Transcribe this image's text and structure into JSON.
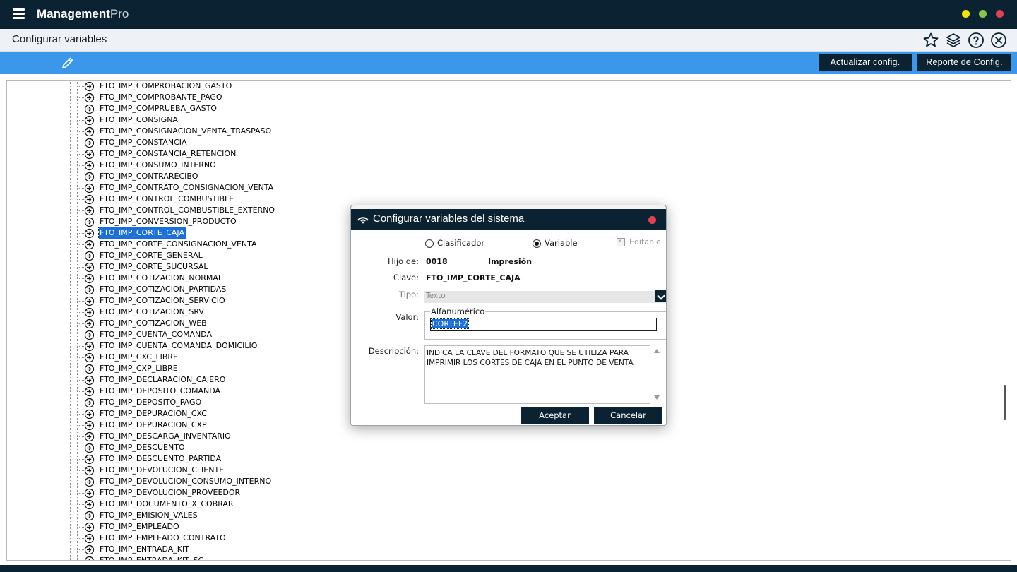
{
  "app": {
    "brand_bold": "Management",
    "brand_light": "Pro",
    "window_dots": [
      "#f5e20a",
      "#8bc34a",
      "#e0434e"
    ]
  },
  "header": {
    "title": "Configurar variables",
    "icons": [
      "star-icon",
      "layers-icon",
      "help-icon",
      "close-circle-icon"
    ]
  },
  "toolbar": {
    "edit_icon": "pencil-icon",
    "update_label": "Actualizar config.",
    "report_label": "Reporte de Config."
  },
  "tree": {
    "selected": "FTO_IMP_CORTE_CAJA",
    "items": [
      "FTO_IMP_COMPROBACION_GASTO",
      "FTO_IMP_COMPROBANTE_PAGO",
      "FTO_IMP_COMPRUEBA_GASTO",
      "FTO_IMP_CONSIGNA",
      "FTO_IMP_CONSIGNACION_VENTA_TRASPASO",
      "FTO_IMP_CONSTANCIA",
      "FTO_IMP_CONSTANCIA_RETENCION",
      "FTO_IMP_CONSUMO_INTERNO",
      "FTO_IMP_CONTRARECIBO",
      "FTO_IMP_CONTRATO_CONSIGNACION_VENTA",
      "FTO_IMP_CONTROL_COMBUSTIBLE",
      "FTO_IMP_CONTROL_COMBUSTIBLE_EXTERNO",
      "FTO_IMP_CONVERSION_PRODUCTO",
      "FTO_IMP_CORTE_CAJA",
      "FTO_IMP_CORTE_CONSIGNACION_VENTA",
      "FTO_IMP_CORTE_GENERAL",
      "FTO_IMP_CORTE_SUCURSAL",
      "FTO_IMP_COTIZACION_NORMAL",
      "FTO_IMP_COTIZACION_PARTIDAS",
      "FTO_IMP_COTIZACION_SERVICIO",
      "FTO_IMP_COTIZACION_SRV",
      "FTO_IMP_COTIZACION_WEB",
      "FTO_IMP_CUENTA_COMANDA",
      "FTO_IMP_CUENTA_COMANDA_DOMICILIO",
      "FTO_IMP_CXC_LIBRE",
      "FTO_IMP_CXP_LIBRE",
      "FTO_IMP_DECLARACION_CAJERO",
      "FTO_IMP_DEPOSITO_COMANDA",
      "FTO_IMP_DEPOSITO_PAGO",
      "FTO_IMP_DEPURACION_CXC",
      "FTO_IMP_DEPURACION_CXP",
      "FTO_IMP_DESCARGA_INVENTARIO",
      "FTO_IMP_DESCUENTO",
      "FTO_IMP_DESCUENTO_PARTIDA",
      "FTO_IMP_DEVOLUCION_CLIENTE",
      "FTO_IMP_DEVOLUCION_CONSUMO_INTERNO",
      "FTO_IMP_DEVOLUCION_PROVEEDOR",
      "FTO_IMP_DOCUMENTO_X_COBRAR",
      "FTO_IMP_EMISION_VALES",
      "FTO_IMP_EMPLEADO",
      "FTO_IMP_EMPLEADO_CONTRATO",
      "FTO_IMP_ENTRADA_KIT",
      "FTO_IMP_ENTRADA_KIT_SC"
    ]
  },
  "dialog": {
    "title": "Configurar variables del sistema",
    "radio_clasificador": "Clasificador",
    "radio_variable": "Variable",
    "selected_radio": "Variable",
    "editable_label": "Editable",
    "editable_checked": true,
    "hijo_label": "Hijo de:",
    "hijo_code": "0018",
    "hijo_name": "Impresión",
    "clave_label": "Clave:",
    "clave_value": "FTO_IMP_CORTE_CAJA",
    "tipo_label": "Tipo:",
    "tipo_value": "Texto",
    "valor_label": "Valor:",
    "valor_group": "Alfanumérico",
    "valor_value": "CORTEF2",
    "descripcion_label": "Descripción:",
    "descripcion_value": "INDICA LA CLAVE DEL FORMATO QUE SE UTILIZA PARA\nIMPRIMIR LOS CORTES DE CAJA EN EL PUNTO DE VENTA",
    "accept_label": "Aceptar",
    "cancel_label": "Cancelar"
  }
}
